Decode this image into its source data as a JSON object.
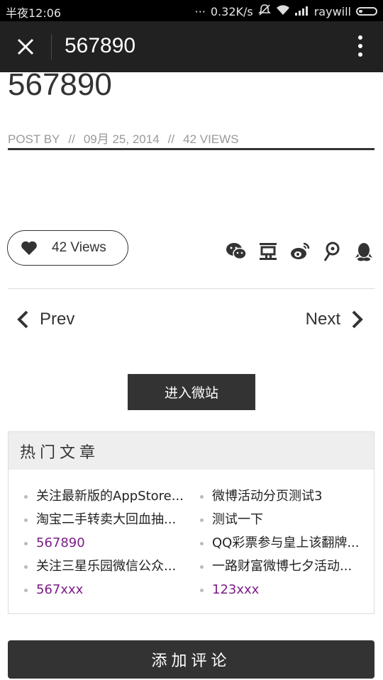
{
  "status_bar": {
    "time": "半夜12:06",
    "network_speed": "0.32K/s",
    "carrier": "raywill"
  },
  "header": {
    "title": "567890"
  },
  "article": {
    "title": "567890",
    "meta": {
      "post_by": "POST BY",
      "sep": "//",
      "date": "09月 25, 2014",
      "views": "42 VIEWS"
    }
  },
  "views_pill": {
    "label": "42 Views"
  },
  "share_icons": [
    "wechat-icon",
    "douban-icon",
    "weibo-icon",
    "tencent-weibo-icon",
    "qq-icon"
  ],
  "nav": {
    "prev": "Prev",
    "next": "Next"
  },
  "micro_site_button": "进入微站",
  "hot_articles": {
    "heading": "热门文章",
    "left": [
      {
        "title": "关注最新版的AppStore..."
      },
      {
        "title": "淘宝二手转卖大回血抽..."
      },
      {
        "title": "567890"
      },
      {
        "title": "关注三星乐园微信公众..."
      },
      {
        "title": "567xxx"
      }
    ],
    "right": [
      {
        "title": "微博活动分页测试3"
      },
      {
        "title": "测试一下"
      },
      {
        "title": "QQ彩票参与皇上该翻牌..."
      },
      {
        "title": "一路财富微博七夕活动..."
      },
      {
        "title": "123xxx"
      }
    ]
  },
  "comment_button": "添加评论",
  "colors": {
    "header_bg": "#212121",
    "dark_button": "#333333",
    "visited_link": "#7b1c87"
  }
}
